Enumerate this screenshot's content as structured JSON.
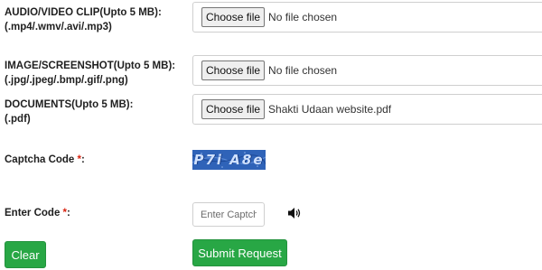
{
  "form": {
    "audio": {
      "label_line1": "AUDIO/VIDEO CLIP(Upto 5 MB):",
      "label_line2": "(.mp4/.wmv/.avi/.mp3)",
      "button": "Choose file",
      "status": "No file chosen"
    },
    "image": {
      "label_line1": "IMAGE/SCREENSHOT(Upto 5 MB):",
      "label_line2": "(.jpg/.jpeg/.bmp/.gif/.png)",
      "button": "Choose file",
      "status": "No file chosen"
    },
    "documents": {
      "label_line1": "DOCUMENTS(Upto 5 MB):",
      "label_line2": "(.pdf)",
      "button": "Choose file",
      "status": "Shakti Udaan website.pdf"
    },
    "captcha": {
      "label": "Captcha Code ",
      "required_mark": "*",
      "code_text": "P7i A8e"
    },
    "enter_code": {
      "label": "Enter Code ",
      "required_mark": "*",
      "placeholder": "Enter Captch",
      "audio_icon": "speaker-icon"
    },
    "clear_button": "Clear",
    "submit_button": "Submit Request"
  },
  "colors": {
    "button_green": "#28a745",
    "required_red": "#d9230f",
    "captcha_blue": "#2f63b8"
  }
}
